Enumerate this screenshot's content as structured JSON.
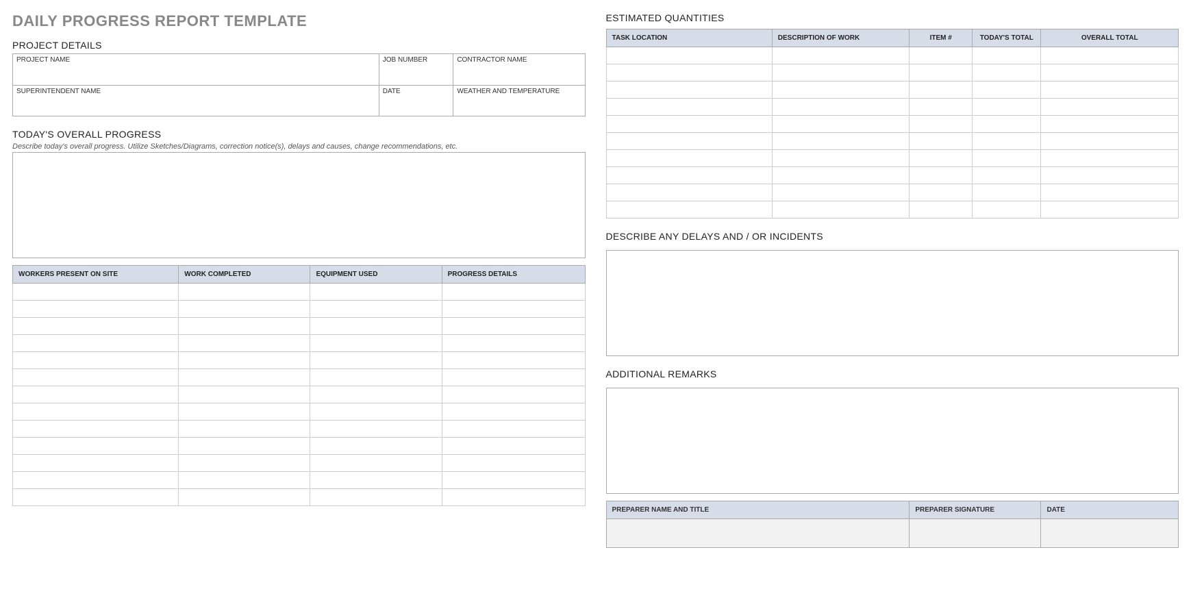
{
  "title": "DAILY PROGRESS REPORT TEMPLATE",
  "sections": {
    "project_details": "PROJECT DETAILS",
    "overall_progress": "TODAY'S OVERALL PROGRESS",
    "estimated_quantities": "ESTIMATED QUANTITIES",
    "delays": "DESCRIBE ANY DELAYS AND / OR INCIDENTS",
    "remarks": "ADDITIONAL REMARKS"
  },
  "details": {
    "project_name": "PROJECT NAME",
    "job_number": "JOB NUMBER",
    "contractor_name": "CONTRACTOR NAME",
    "superintendent_name": "SUPERINTENDENT NAME",
    "date": "DATE",
    "weather": "WEATHER AND TEMPERATURE"
  },
  "progress_instructions": "Describe today's overall progress.  Utilize Sketches/Diagrams, correction notice(s), delays and causes, change recommendations, etc.",
  "progress_table_headers": {
    "workers": "WORKERS PRESENT ON SITE",
    "work_completed": "WORK COMPLETED",
    "equipment": "EQUIPMENT USED",
    "progress_details": "PROGRESS DETAILS"
  },
  "quantities_headers": {
    "task_location": "TASK LOCATION",
    "description": "DESCRIPTION OF WORK",
    "item": "ITEM #",
    "todays_total": "TODAY'S TOTAL",
    "overall_total": "OVERALL TOTAL"
  },
  "signoff": {
    "preparer": "PREPARER NAME AND TITLE",
    "signature": "PREPARER SIGNATURE",
    "date": "DATE"
  }
}
